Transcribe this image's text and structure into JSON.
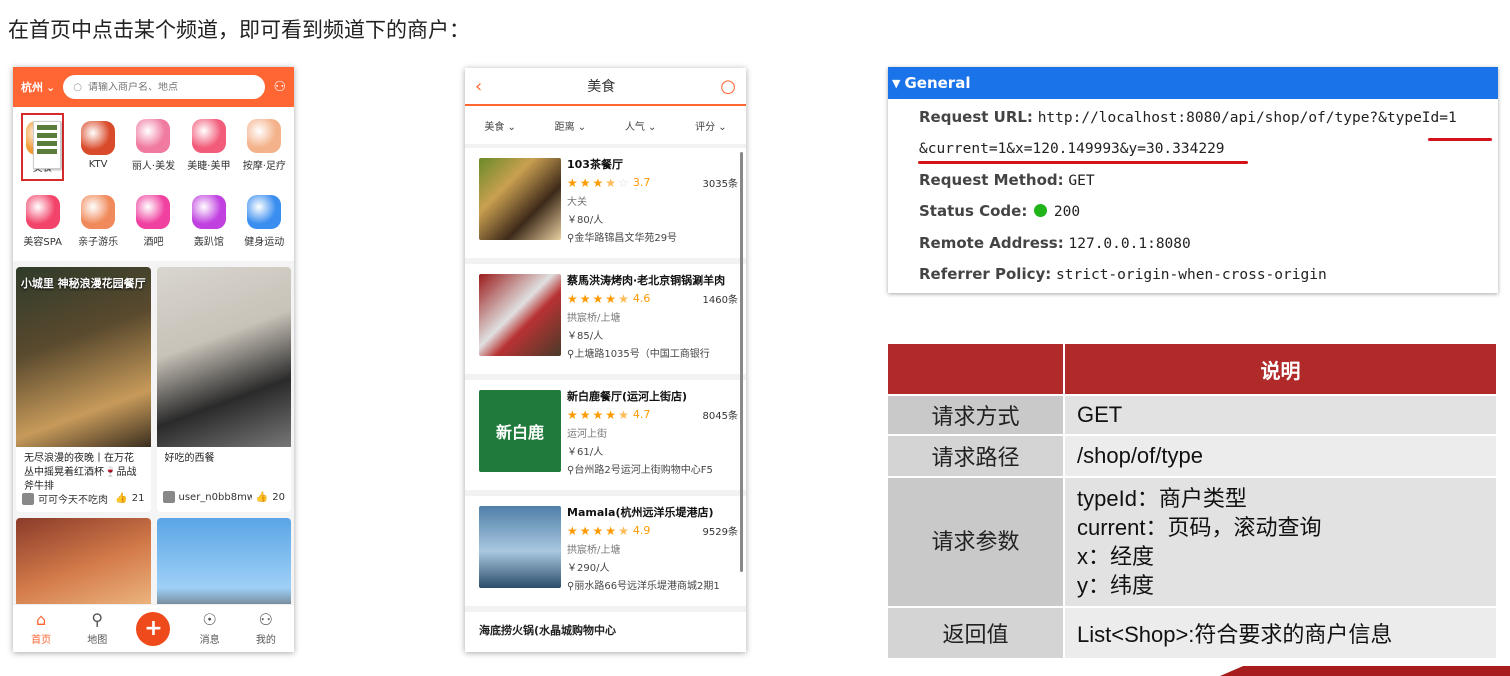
{
  "heading": "在首页中点击某个频道，即可看到频道下的商户：",
  "phone1": {
    "city": "杭州",
    "search_placeholder": "请输入商户名、地点",
    "categories": [
      {
        "label": "美食",
        "color": "#f29b38"
      },
      {
        "label": "KTV",
        "color": "#d94a2a"
      },
      {
        "label": "丽人·美发",
        "color": "#f07aa0"
      },
      {
        "label": "美睫·美甲",
        "color": "#f25c7a"
      },
      {
        "label": "按摩·足疗",
        "color": "#f4b28a"
      },
      {
        "label": "美容SPA",
        "color": "#f2446a"
      },
      {
        "label": "亲子游乐",
        "color": "#f08a5a"
      },
      {
        "label": "酒吧",
        "color": "#f040a0"
      },
      {
        "label": "轰趴馆",
        "color": "#c040e0"
      },
      {
        "label": "健身运动",
        "color": "#3a8ef0"
      }
    ],
    "feed": [
      {
        "overlay": "小城里 神秘浪漫花园餐厅",
        "title": "无尽浪漫的夜晚丨在万花丛中摇晃着红酒杯🍷品战斧牛排",
        "user": "可可今天不吃肉",
        "likes": "21"
      },
      {
        "overlay": "",
        "title": "好吃的西餐",
        "user": "user_n0bb8mw",
        "likes": "20"
      }
    ],
    "tabs": [
      {
        "label": "首页",
        "icon": "home-icon"
      },
      {
        "label": "地图",
        "icon": "map-pin-icon"
      },
      {
        "label": "",
        "icon": "plus-icon"
      },
      {
        "label": "消息",
        "icon": "message-icon"
      },
      {
        "label": "我的",
        "icon": "user-icon"
      }
    ]
  },
  "phone2": {
    "title": "美食",
    "filters": [
      "美食",
      "距离",
      "人气",
      "评分"
    ],
    "shops": [
      {
        "name": "103茶餐厅",
        "stars": 3.7,
        "score": "3.7",
        "comments": "3035条",
        "area": "大关",
        "price": "￥80/人",
        "address": "金华路锦昌文华苑29号",
        "img_text": ""
      },
      {
        "name": "蔡馬洪涛烤肉·老北京铜锅涮羊肉",
        "stars": 4.6,
        "score": "4.6",
        "comments": "1460条",
        "area": "拱宸桥/上塘",
        "price": "￥85/人",
        "address": "上塘路1035号（中国工商银行",
        "img_text": ""
      },
      {
        "name": "新白鹿餐厅(运河上街店)",
        "stars": 4.7,
        "score": "4.7",
        "comments": "8045条",
        "area": "运河上街",
        "price": "￥61/人",
        "address": "台州路2号运河上街购物中心F5",
        "img_text": "新白鹿"
      },
      {
        "name": "Mamala(杭州远洋乐堤港店)",
        "stars": 4.9,
        "score": "4.9",
        "comments": "9529条",
        "area": "拱宸桥/上塘",
        "price": "￥290/人",
        "address": "丽水路66号远洋乐堤港商城2期1",
        "img_text": ""
      }
    ],
    "last_shop": "海底捞火锅(水晶城购物中心"
  },
  "general": {
    "section": "General",
    "rows": [
      {
        "key": "Request URL:",
        "value": "http://localhost:8080/api/shop/of/type?&typeId=1"
      },
      {
        "key": "",
        "value": "&current=1&x=120.149993&y=30.334229"
      },
      {
        "key": "Request Method:",
        "value": "GET"
      },
      {
        "key": "Status Code:",
        "value": "200"
      },
      {
        "key": "Remote Address:",
        "value": "127.0.0.1:8080"
      },
      {
        "key": "Referrer Policy:",
        "value": "strict-origin-when-cross-origin"
      }
    ],
    "status_color": "#22b51a"
  },
  "table": {
    "header": "说明",
    "rows": [
      {
        "label": "请求方式",
        "value": "GET"
      },
      {
        "label": "请求路径",
        "value": "/shop/of/type"
      },
      {
        "label": "请求参数",
        "lines": [
          "typeId：商户类型",
          "current：页码，滚动查询",
          "x：经度",
          "y：纬度"
        ]
      },
      {
        "label": "返回值",
        "value": "List<Shop>:符合要求的商户信息"
      }
    ],
    "header_color": "#b02a2a"
  }
}
